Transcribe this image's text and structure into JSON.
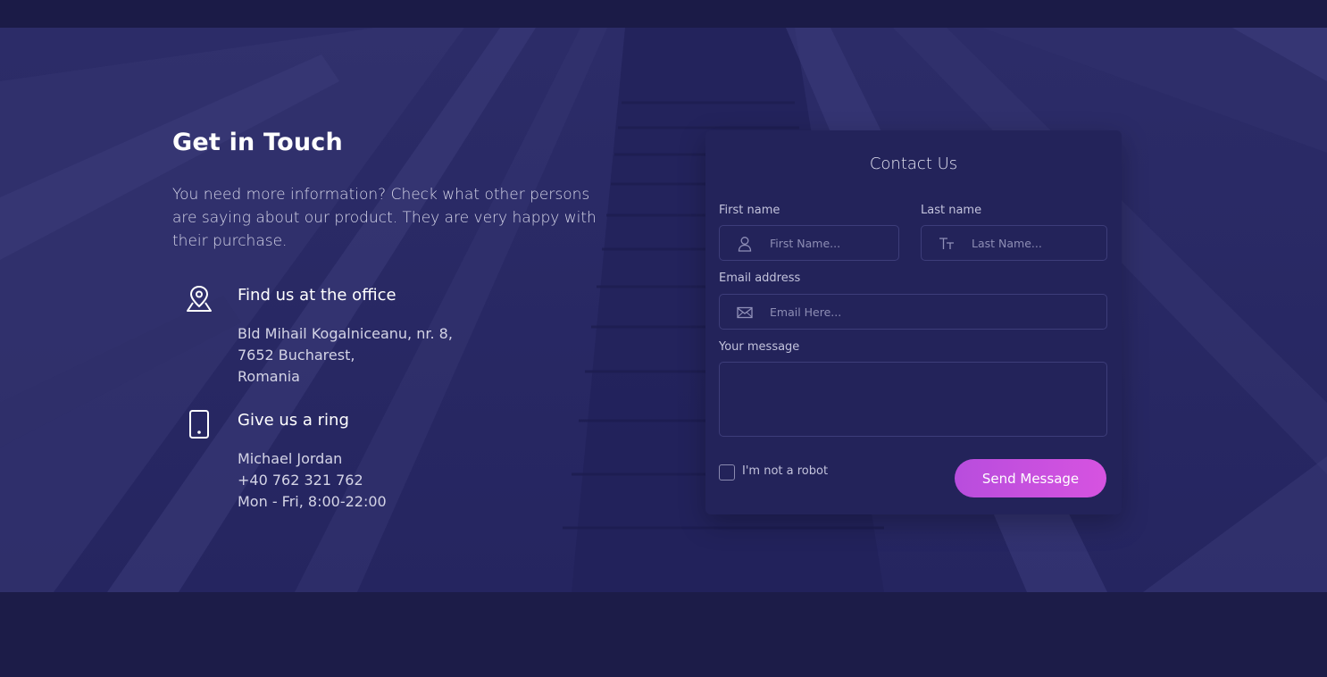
{
  "section": {
    "title": "Get in Touch",
    "intro": "You need more information? Check what other persons are saying about our product. They are very happy with their purchase."
  },
  "office": {
    "icon": "map-pin-icon",
    "title": "Find us at the office",
    "lines": [
      "Bld Mihail Kogalniceanu, nr. 8,",
      "7652 Bucharest,",
      "Romania"
    ]
  },
  "phone": {
    "icon": "mobile-phone-icon",
    "title": "Give us a ring",
    "lines": [
      "Michael Jordan",
      "+40 762 321 762",
      "Mon - Fri, 8:00-22:00"
    ]
  },
  "form": {
    "title": "Contact Us",
    "first_name": {
      "label": "First name",
      "placeholder": "First Name...",
      "icon": "user-icon"
    },
    "last_name": {
      "label": "Last name",
      "placeholder": "Last Name...",
      "icon": "text-size-icon"
    },
    "email": {
      "label": "Email address",
      "placeholder": "Email Here...",
      "icon": "envelope-icon"
    },
    "message": {
      "label": "Your message",
      "value": ""
    },
    "robot_label": "I'm not a robot",
    "send_label": "Send Message"
  },
  "colors": {
    "background": "#1c1c48",
    "card": "#23235a",
    "accent": "#c84fdf"
  }
}
